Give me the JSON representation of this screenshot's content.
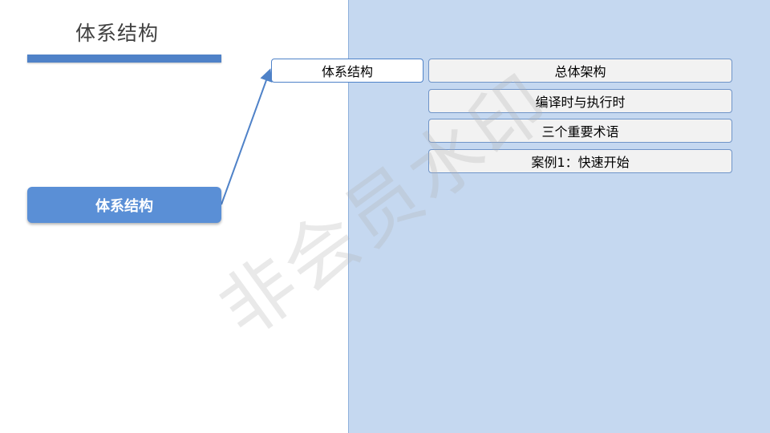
{
  "slide": {
    "title": "体系结构"
  },
  "main_node": {
    "label": "体系结构"
  },
  "sub_node": {
    "label": "体系结构"
  },
  "items": [
    {
      "label": "总体架构"
    },
    {
      "label": "编译时与执行时"
    },
    {
      "label": "三个重要术语"
    },
    {
      "label": "案例1：快速开始"
    }
  ],
  "watermark": {
    "text": "非会员水印"
  },
  "colors": {
    "accent": "#4f82c8",
    "main_node": "#5a8fd6",
    "panel": "#c5d8f0",
    "item_fill": "#f2f2f2"
  }
}
